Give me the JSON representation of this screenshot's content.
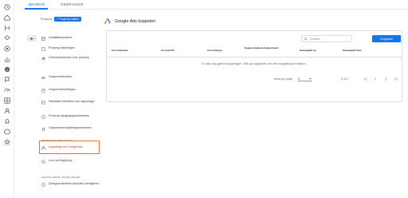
{
  "tabs": [
    {
      "label": "BEHEER",
      "active": true
    },
    {
      "label": "GEBRUIKER",
      "active": false
    }
  ],
  "property": {
    "label": "Property",
    "chip": "+ Property maken"
  },
  "rail_icons": [
    "clock-icon",
    "home-icon",
    "branch-icon",
    "layers-icon",
    "target-icon",
    "chart-icon",
    "info-icon",
    "flag-icon",
    "speed-icon",
    "grid-icon",
    "person-icon",
    "bell-icon",
    "box-icon",
    "settings-icon"
  ],
  "nav": {
    "items": [
      {
        "label": "Installatieassistent",
        "icon": "list-icon"
      },
      {
        "label": "Property-instellingen",
        "icon": "doc-icon"
      },
      {
        "label": "Gebruikersbeheer voor property",
        "icon": "people-icon"
      },
      {
        "label": "Gegevensstreams",
        "icon": "stream-icon"
      },
      {
        "label": "Gegevensinstellingen",
        "icon": "db-icon"
      },
      {
        "label": "Standaard identiteit voor rapportage",
        "icon": "id-icon"
      },
      {
        "label": "Property wijzigingsgeschiedenis",
        "icon": "history-icon"
      },
      {
        "label": "Gegevensverwijderingsverzoeken",
        "icon": "trash-icon"
      }
    ],
    "section_products": "PRODUCTKOPPELINGEN",
    "products": [
      {
        "label": "Koppeling met Google Ads",
        "icon": "ads-icon",
        "active": true
      },
      {
        "label": "Link met BigQuery",
        "icon": "bigquery-icon",
        "active": false
      }
    ],
    "section_extra": "AANVULLENDE INSTELLINGEN",
    "extra": [
      {
        "label": "Zoekgeschiedenis Analytics Intelligence",
        "icon": "search-history-icon"
      }
    ]
  },
  "main": {
    "title": "Google Ads koppelen",
    "search_placeholder": "Zoeken",
    "primary_button": "Koppelen",
    "columns": [
      "Accountnaam",
      "Account ID",
      "Accounttype",
      "Gepersonaliseerd adverteren",
      "Gekoppeld op",
      "Gekoppeld door"
    ],
    "empty_message": "Er zijn nog geen koppelingen. Klik op Koppelen om een koppeling te maken.",
    "pager": {
      "label": "Items per page:",
      "page_size": "5",
      "range": "0 of 0"
    }
  },
  "colors": {
    "accent": "#1a73e8",
    "active_nav": "#d93025",
    "highlight_box": "#e8711a"
  }
}
